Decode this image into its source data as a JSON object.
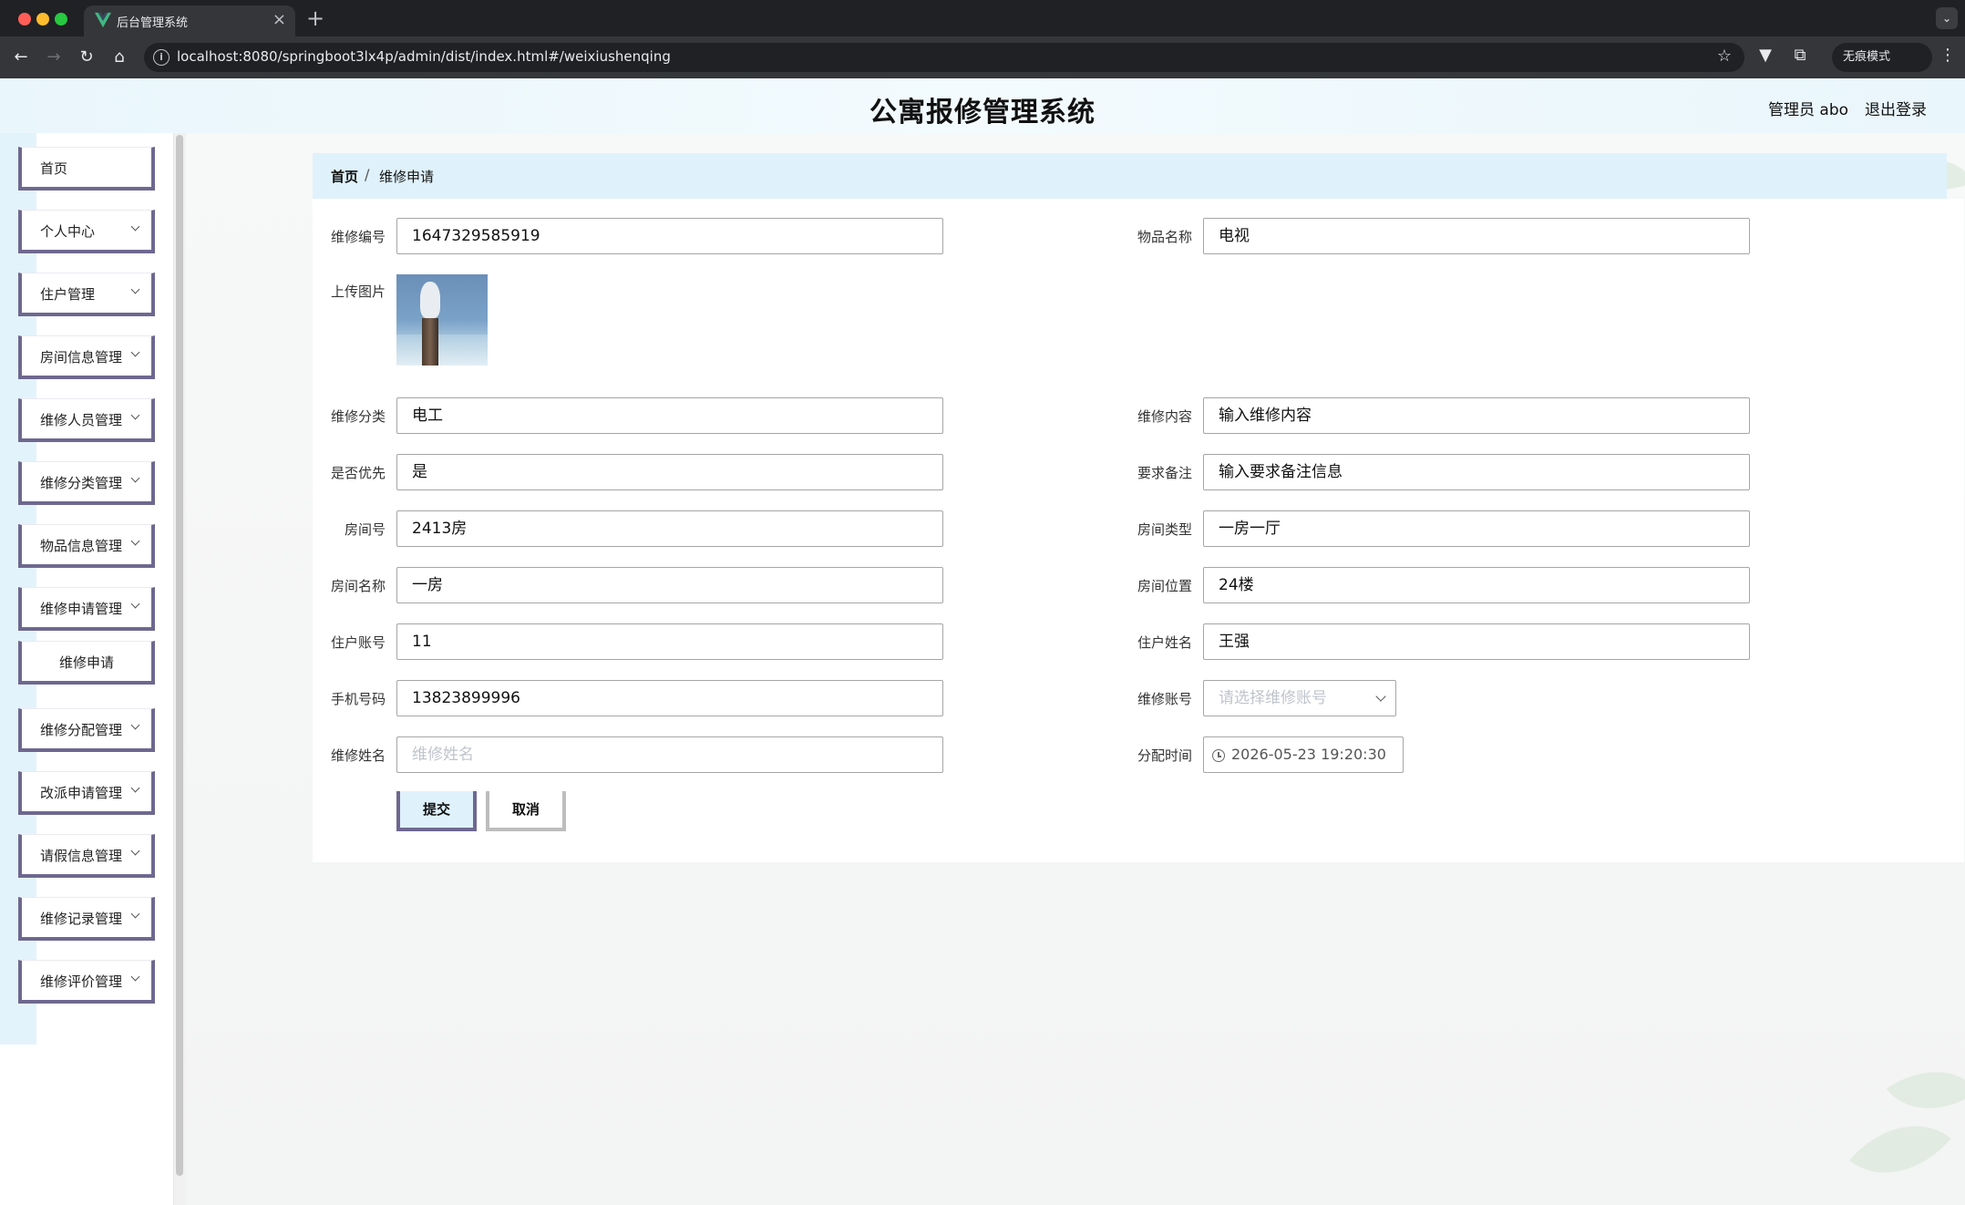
{
  "browser": {
    "tab_title": "后台管理系统",
    "url": "localhost:8080/springboot3lx4p/admin/dist/index.html#/weixiushenqing",
    "incognito_label": "无痕模式"
  },
  "header": {
    "title": "公寓报修管理系统",
    "user": "管理员 abo",
    "logout": "退出登录"
  },
  "sidebar": {
    "items": [
      {
        "label": "首页"
      },
      {
        "label": "个人中心"
      },
      {
        "label": "住户管理"
      },
      {
        "label": "房间信息管理"
      },
      {
        "label": "维修人员管理"
      },
      {
        "label": "维修分类管理"
      },
      {
        "label": "物品信息管理"
      },
      {
        "label": "维修申请管理"
      },
      {
        "label": "维修申请"
      },
      {
        "label": "维修分配管理"
      },
      {
        "label": "改派申请管理"
      },
      {
        "label": "请假信息管理"
      },
      {
        "label": "维修记录管理"
      },
      {
        "label": "维修评价管理"
      }
    ]
  },
  "breadcrumb": {
    "home": "首页",
    "separator": "/",
    "current": "维修申请"
  },
  "form": {
    "repair_no": {
      "label": "维修编号",
      "value": "1647329585919"
    },
    "item_name": {
      "label": "物品名称",
      "value": "电视"
    },
    "upload": {
      "label": "上传图片"
    },
    "category": {
      "label": "维修分类",
      "value": "电工"
    },
    "content": {
      "label": "维修内容",
      "value": "输入维修内容"
    },
    "priority": {
      "label": "是否优先",
      "value": "是"
    },
    "remark": {
      "label": "要求备注",
      "value": "输入要求备注信息"
    },
    "room_no": {
      "label": "房间号",
      "value": "2413房"
    },
    "room_type": {
      "label": "房间类型",
      "value": "一房一厅"
    },
    "room_name": {
      "label": "房间名称",
      "value": "一房"
    },
    "room_location": {
      "label": "房间位置",
      "value": "24楼"
    },
    "resident_account": {
      "label": "住户账号",
      "value": "11"
    },
    "resident_name": {
      "label": "住户姓名",
      "value": "王强"
    },
    "phone": {
      "label": "手机号码",
      "value": "13823899996"
    },
    "repair_account": {
      "label": "维修账号",
      "placeholder": "请选择维修账号"
    },
    "repair_name": {
      "label": "维修姓名",
      "placeholder": "维修姓名"
    },
    "assign_time": {
      "label": "分配时间",
      "value": "2026-05-23 19:20:30"
    },
    "submit": "提交",
    "cancel": "取消"
  }
}
